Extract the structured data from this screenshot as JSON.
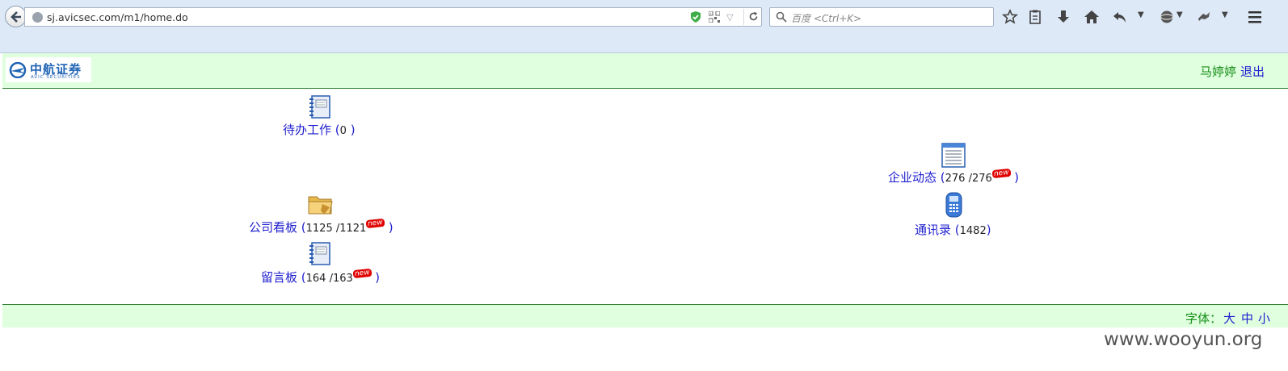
{
  "browser": {
    "url": "sj.avicsec.com/m1/home.do",
    "search_placeholder": "百度 <Ctrl+K>"
  },
  "header": {
    "logo_cn": "中航证券",
    "logo_en": "AVIC SECURITIES",
    "user_name": "马婷婷",
    "logout": "退出"
  },
  "items": {
    "todo": {
      "label": "待办工作",
      "open": " (",
      "count": "0",
      "close": " )",
      "icon": "notebook-icon"
    },
    "board": {
      "label": "公司看板",
      "open": " (",
      "count": "1125 /1121",
      "badge": "new",
      "close": " )",
      "icon": "folder-icon"
    },
    "messages": {
      "label": "留言板",
      "open": " (",
      "count": "164 /163",
      "badge": "new",
      "close": " )",
      "icon": "notebook-icon"
    },
    "news": {
      "label": "企业动态",
      "open": " (",
      "count": "276 /276",
      "badge": "new",
      "close": " )",
      "icon": "list-document-icon"
    },
    "contacts": {
      "label": "通讯录",
      "open": " (",
      "count": "1482",
      "close": ")",
      "icon": "phone-icon"
    }
  },
  "footer": {
    "font_label": "字体：",
    "sizes": [
      "大",
      "中",
      "小"
    ]
  },
  "watermark": "www.wooyun.org",
  "colors": {
    "header_bg": "#dfffdf",
    "link": "#1f1fcf",
    "green_text": "#1a8f1a",
    "chrome_bg": "#dde9f7"
  }
}
